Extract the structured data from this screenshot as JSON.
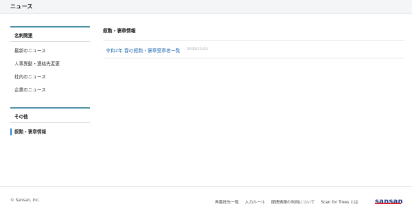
{
  "header": {
    "title": "ニュース"
  },
  "sidebar": {
    "section1": {
      "title": "名刺関連",
      "items": [
        {
          "label": "最新のニュース"
        },
        {
          "label": "人事異動・連絡先変更"
        },
        {
          "label": "社内のニュース"
        },
        {
          "label": "企業のニュース"
        }
      ]
    },
    "section2": {
      "title": "その他",
      "items": [
        {
          "label": "叙勲・褒章情報",
          "active": true
        }
      ]
    }
  },
  "main": {
    "title": "叙勲・褒章情報",
    "articles": [
      {
        "title": "令和2年 春の叙勲・褒章受章者一覧",
        "date": "2020/11/02"
      }
    ]
  },
  "footer": {
    "copyright": "© Sansan, Inc.",
    "links": [
      "再委託先一覧",
      "入力ルール",
      "提携情報の利用について",
      "Scan for Trees とは"
    ],
    "logo_text": "sansan"
  },
  "colors": {
    "accent": "#4a90a4",
    "link": "#2a6fb6",
    "active": "#2a7fd4",
    "logo": "#1f3d8a",
    "logo_bar": "#d8232a"
  }
}
